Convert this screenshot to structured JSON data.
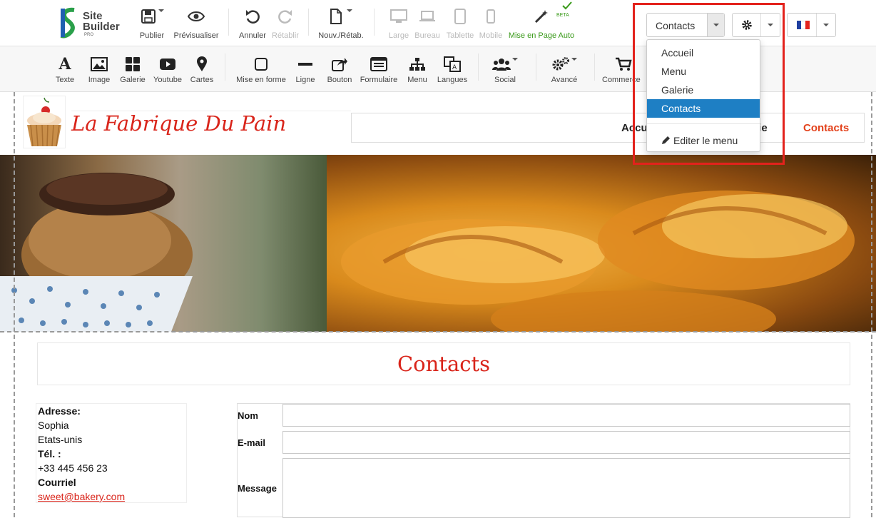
{
  "app": {
    "logo_line1": "Site",
    "logo_line2": "Builder",
    "logo_line3": "PRO"
  },
  "toolbar": {
    "publish": "Publier",
    "preview": "Prévisualiser",
    "undo": "Annuler",
    "redo": "Rétablir",
    "new_restore": "Nouv./Rétab.",
    "large": "Large",
    "desktop": "Bureau",
    "tablet": "Tablette",
    "mobile": "Mobile",
    "auto_layout": "Mise en Page Auto",
    "auto_layout_badge": "BETA"
  },
  "page_selector": {
    "current": "Contacts"
  },
  "language": {
    "flag_colors": [
      "#1f3fa0",
      "#ffffff",
      "#e3221c"
    ]
  },
  "insert_bar": {
    "items": [
      "Texte",
      "Image",
      "Galerie",
      "Youtube",
      "Cartes",
      "Mise en forme",
      "Ligne",
      "Bouton",
      "Formulaire",
      "Menu",
      "Langues",
      "Social",
      "Avancé",
      "Commerce"
    ]
  },
  "page_menu": {
    "items": [
      "Accueil",
      "Menu",
      "Galerie",
      "Contacts"
    ],
    "active_index": 3,
    "edit_label": "Editer le menu"
  },
  "site": {
    "title": "La Fabrique Du Pain",
    "nav": {
      "item1": "Accu",
      "item2": "erie",
      "item3": "Contacts"
    },
    "section_title": "Contacts",
    "address": {
      "address_label": "Adresse:",
      "line1": "Sophia",
      "line2": "Etats-unis",
      "phone_label": "Tél. :",
      "phone": "+33 445 456 23",
      "email_label": "Courriel",
      "email": "sweet@bakery.com"
    },
    "form": {
      "name_label": "Nom",
      "email_label": "E-mail",
      "message_label": "Message"
    }
  },
  "colors": {
    "accent_red": "#d9241a",
    "selection_blue": "#1e7fc4",
    "highlight_red": "#e3221c",
    "green": "#3a9a1a"
  }
}
